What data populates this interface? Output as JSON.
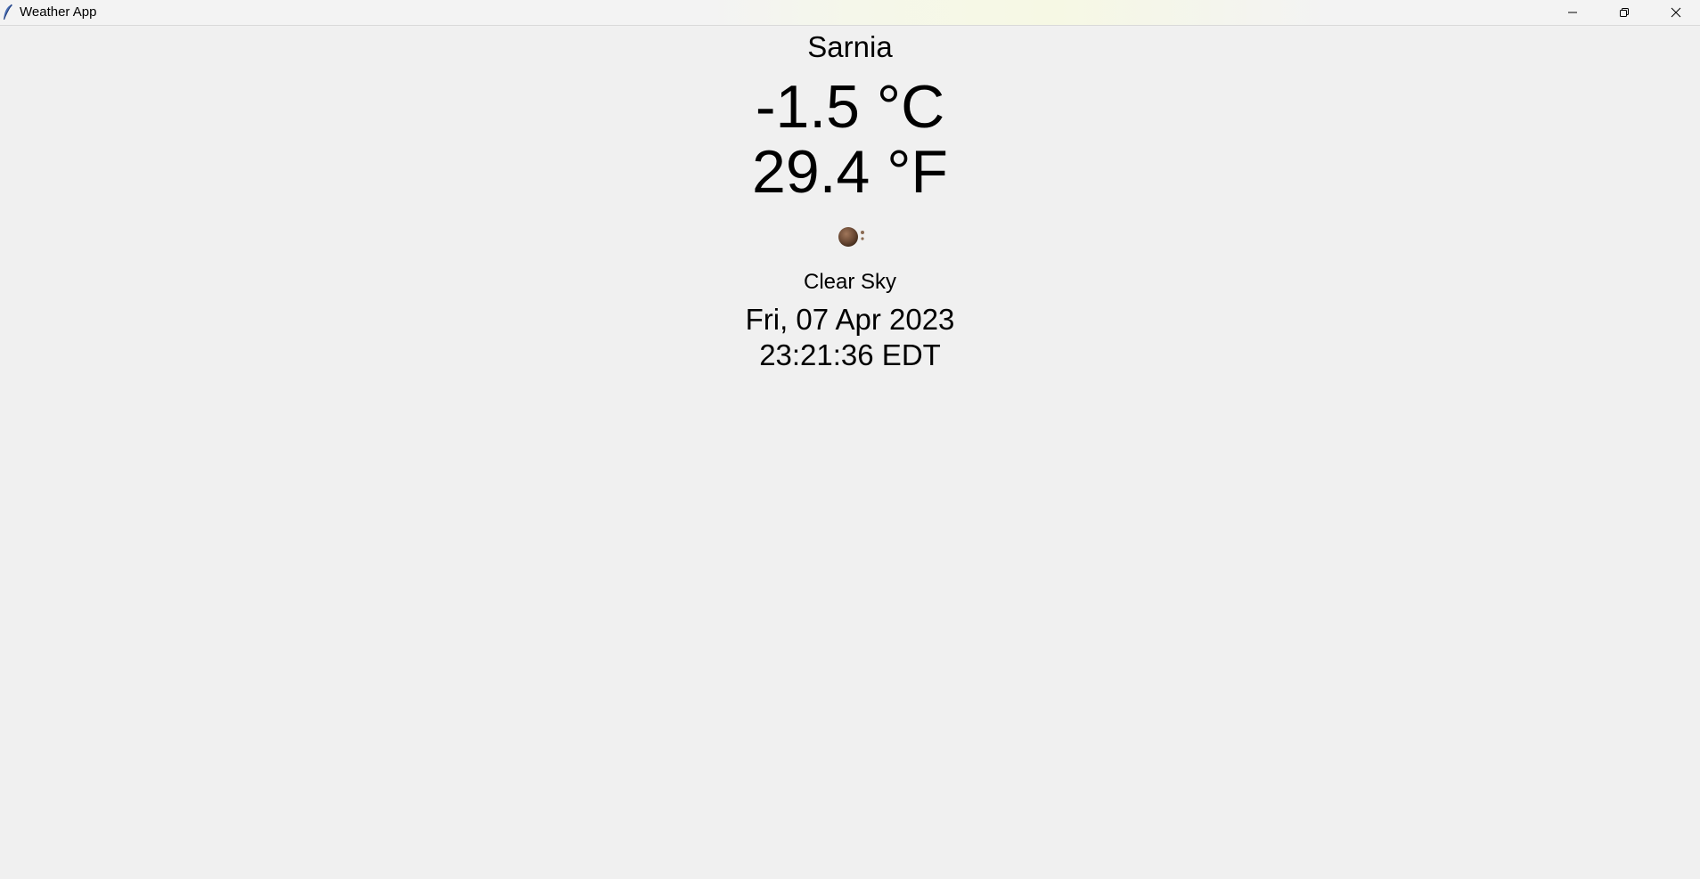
{
  "window": {
    "title": "Weather App",
    "app_icon": "feather-icon",
    "controls": {
      "minimize_icon": "minimize-icon",
      "maximize_icon": "restore-icon",
      "close_icon": "close-icon"
    }
  },
  "weather": {
    "city": "Sarnia",
    "temp_c": "-1.5 °C",
    "temp_f": "29.4 °F",
    "icon": "moon-icon",
    "description": "Clear Sky",
    "date": "Fri, 07 Apr 2023",
    "time": "23:21:36 EDT"
  },
  "colors": {
    "background": "#f0f0f0",
    "text": "#000000",
    "moon": "#6b4a35"
  }
}
